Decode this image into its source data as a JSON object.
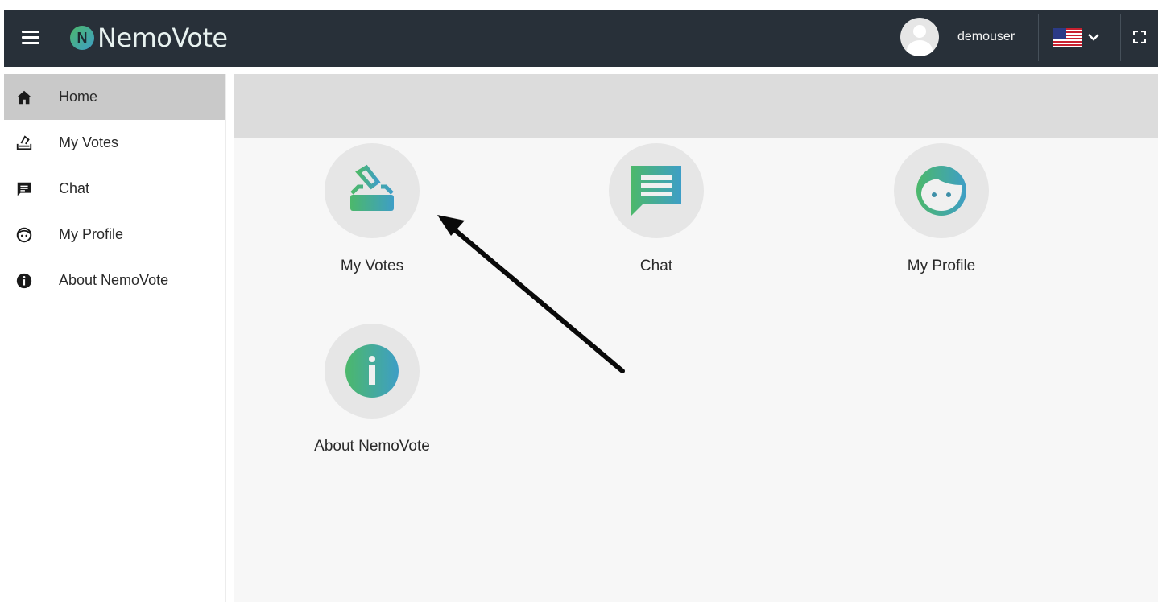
{
  "header": {
    "brand_mark": "N",
    "brand_name": "NemoVote",
    "username": "demouser",
    "language_flag": "us-flag-icon"
  },
  "sidebar": {
    "items": [
      {
        "label": "Home",
        "icon": "home-icon",
        "active": true
      },
      {
        "label": "My Votes",
        "icon": "ballot-icon",
        "active": false
      },
      {
        "label": "Chat",
        "icon": "chat-icon",
        "active": false
      },
      {
        "label": "My Profile",
        "icon": "face-icon",
        "active": false
      },
      {
        "label": "About NemoVote",
        "icon": "info-icon",
        "active": false
      }
    ]
  },
  "main": {
    "tiles": [
      {
        "label": "My Votes",
        "icon": "ballot-icon"
      },
      {
        "label": "Chat",
        "icon": "chat-icon"
      },
      {
        "label": "My Profile",
        "icon": "face-icon"
      },
      {
        "label": "About NemoVote",
        "icon": "info-icon"
      }
    ]
  },
  "annotation": {
    "arrow": "pointing-arrow",
    "target": "My Votes"
  },
  "colors": {
    "topbar": "#283039",
    "gradient_green": "#4cb86b",
    "gradient_blue": "#3e9ec6",
    "active_nav": "#c9c9c9",
    "banner": "#dcdcdc"
  }
}
